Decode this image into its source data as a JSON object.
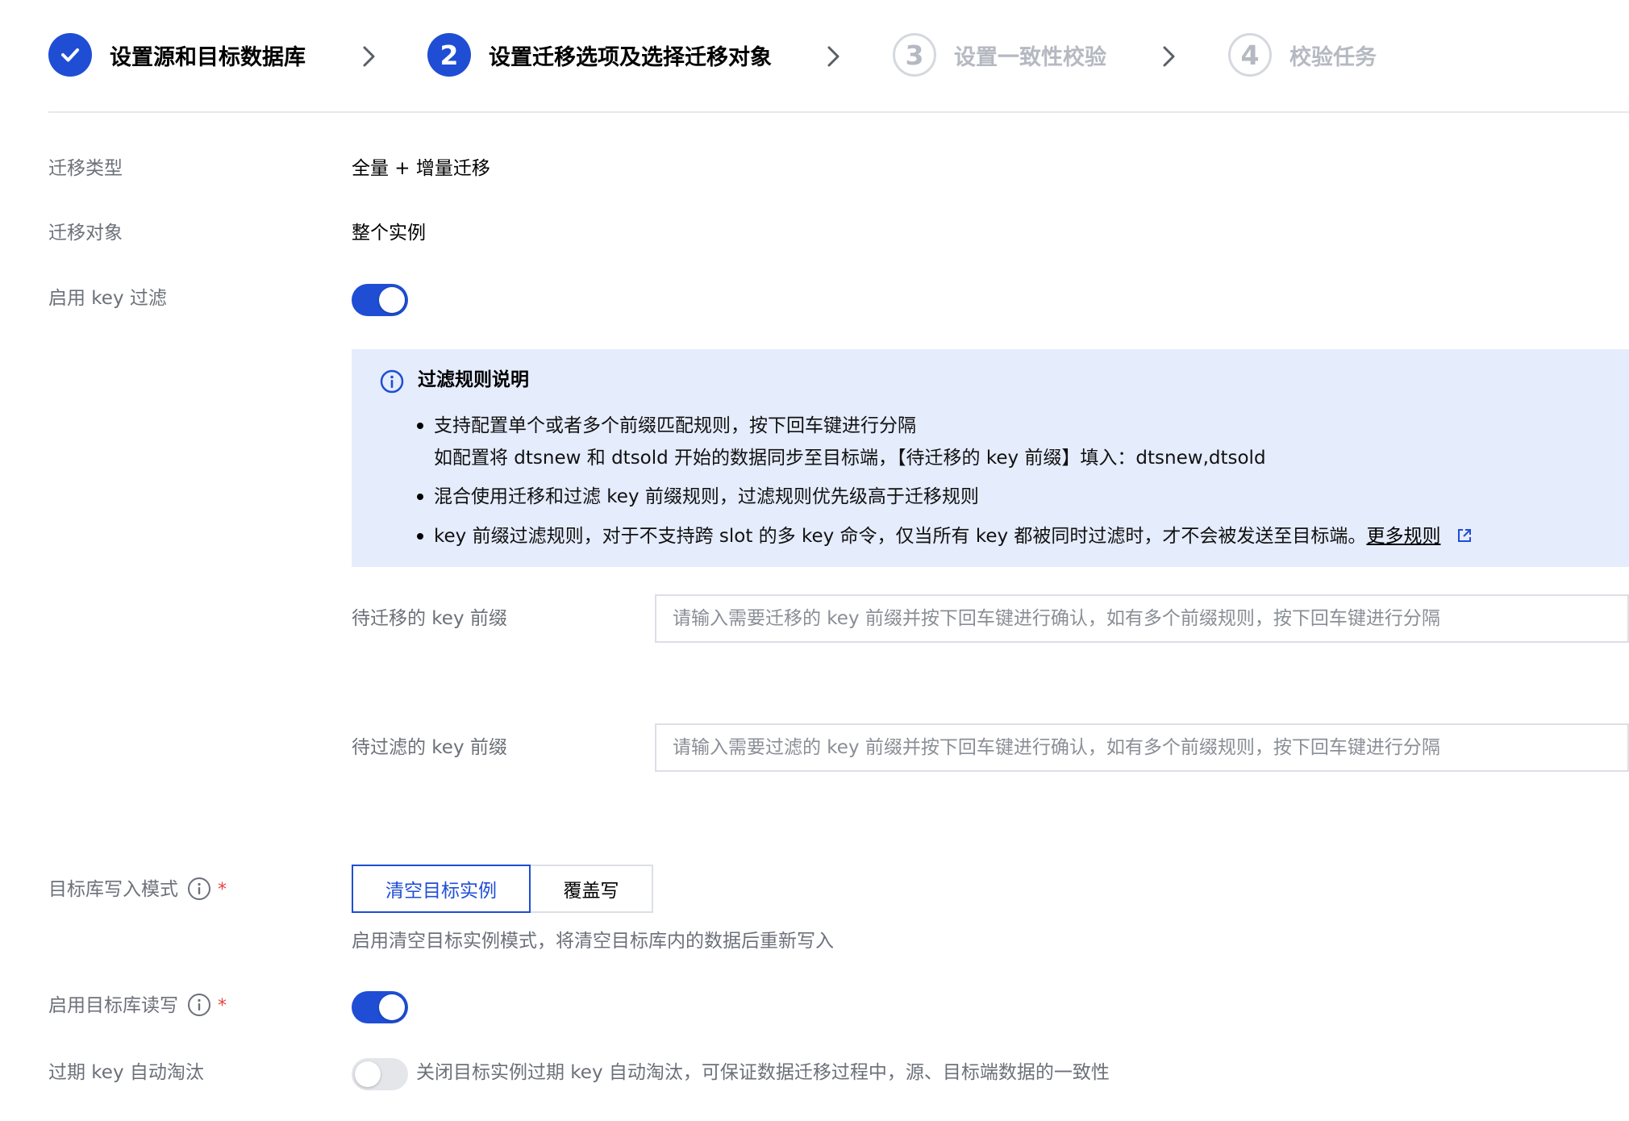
{
  "steps": [
    {
      "index": "1",
      "label": "设置源和目标数据库",
      "state": "done"
    },
    {
      "index": "2",
      "label": "设置迁移选项及选择迁移对象",
      "state": "active"
    },
    {
      "index": "3",
      "label": "设置一致性校验",
      "state": "pending"
    },
    {
      "index": "4",
      "label": "校验任务",
      "state": "pending"
    }
  ],
  "form": {
    "migration_type": {
      "label": "迁移类型",
      "value": "全量 + 增量迁移"
    },
    "migration_object": {
      "label": "迁移对象",
      "value": "整个实例"
    },
    "key_filter": {
      "label": "启用 key 过滤",
      "enabled": true
    },
    "filter_info": {
      "title": "过滤规则说明",
      "items": [
        "支持配置单个或者多个前缀匹配规则，按下回车键进行分隔",
        "如配置将 dtsnew 和 dtsold 开始的数据同步至目标端，【待迁移的 key 前缀】填入：dtsnew,dtsold",
        "混合使用迁移和过滤 key 前缀规则，过滤规则优先级高于迁移规则",
        "key 前缀过滤规则，对于不支持跨 slot 的多 key 命令，仅当所有 key 都被同时过滤时，才不会被发送至目标端。"
      ],
      "more_link": "更多规则"
    },
    "migrate_prefix": {
      "label": "待迁移的 key 前缀",
      "value": "",
      "placeholder": "请输入需要迁移的 key 前缀并按下回车键进行确认，如有多个前缀规则，按下回车键进行分隔"
    },
    "filter_prefix": {
      "label": "待过滤的 key 前缀",
      "value": "",
      "placeholder": "请输入需要过滤的 key 前缀并按下回车键进行确认，如有多个前缀规则，按下回车键进行分隔"
    },
    "write_mode": {
      "label": "目标库写入模式",
      "required_mark": "*",
      "options": [
        "清空目标实例",
        "覆盖写"
      ],
      "selected": "清空目标实例",
      "hint": "启用清空目标实例模式，将清空目标库内的数据后重新写入"
    },
    "target_rw": {
      "label": "启用目标库读写",
      "required_mark": "*",
      "enabled": true
    },
    "expire_key": {
      "label": "过期 key 自动淘汰",
      "enabled": false,
      "hint": "关闭目标实例过期 key 自动淘汰，可保证数据迁移过程中，源、目标端数据的一致性"
    }
  },
  "colors": {
    "primary": "#1f4ed5",
    "info_bg": "#e5ecfc",
    "required": "#e54545",
    "muted": "#6c7079"
  },
  "icons": [
    "check-icon",
    "chevron-right-icon",
    "info-circle-icon",
    "external-link-icon"
  ]
}
